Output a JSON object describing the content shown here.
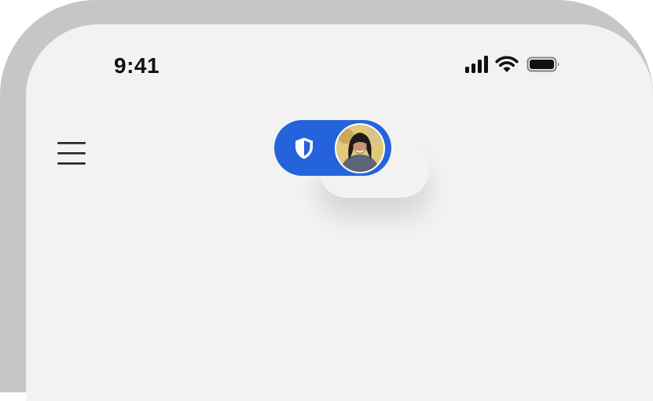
{
  "status_bar": {
    "time": "9:41",
    "icons": [
      "cellular-signal-icon",
      "wifi-icon",
      "battery-icon"
    ]
  },
  "header": {
    "menu_icon": "hamburger-menu-icon",
    "mode_toggle": {
      "icons": [
        "shield-icon",
        "avatar"
      ],
      "color": "#2563dc"
    }
  },
  "colors": {
    "device_frame": "#c6c6c6",
    "screen_background": "#f2f2f2",
    "accent": "#2563dc"
  }
}
